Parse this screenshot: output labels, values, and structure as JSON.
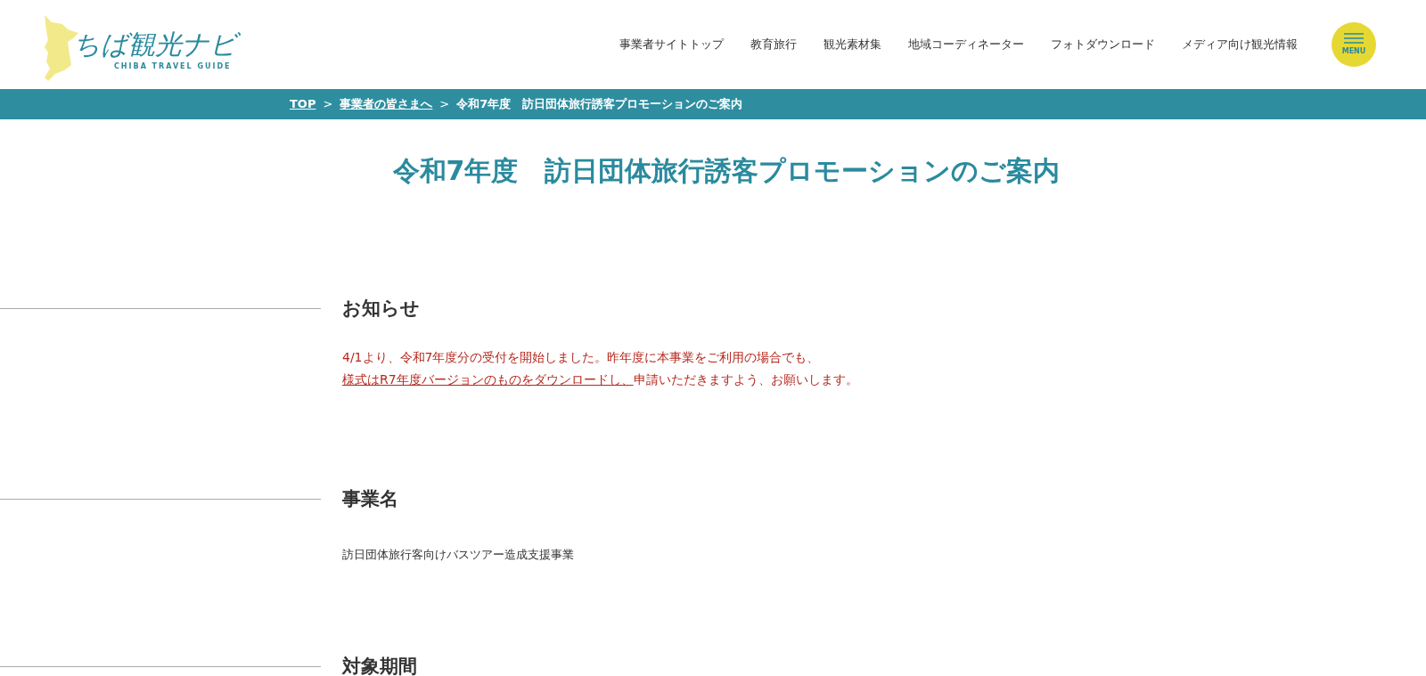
{
  "header": {
    "logo": {
      "title": "ちば観光ナビ",
      "subtitle": "CHIBA TRAVEL GUIDE"
    },
    "nav": [
      "事業者サイトトップ",
      "教育旅行",
      "観光素材集",
      "地域コーディネーター",
      "フォトダウンロード",
      "メディア向け観光情報"
    ],
    "menu_button": "MENU"
  },
  "breadcrumb": [
    {
      "label": "TOP",
      "link": true
    },
    {
      "label": "事業者の皆さまへ",
      "link": true
    },
    {
      "label": "令和7年度　訪日団体旅行誘客プロモーションのご案内",
      "link": false
    }
  ],
  "separator": ">",
  "page_title": "令和7年度　訪日団体旅行誘客プロモーションのご案内",
  "sections": [
    {
      "heading": "お知らせ",
      "kind": "notice",
      "parts": [
        {
          "text": "4/1より、令和7年度分の受付を開始しました。昨年度に本事業をご利用の場合でも、",
          "link": false
        },
        {
          "text": "様式はR7年度バージョンのものをダウンロードし、",
          "link": true
        },
        {
          "text": "申請いただきますよう、お願いします。",
          "link": false
        }
      ]
    },
    {
      "heading": "事業名",
      "kind": "text",
      "parts": [
        {
          "text": "訪日団体旅行客向けバスツアー造成支援事業",
          "link": false
        }
      ]
    },
    {
      "heading": "対象期間",
      "kind": "text"
    }
  ]
}
